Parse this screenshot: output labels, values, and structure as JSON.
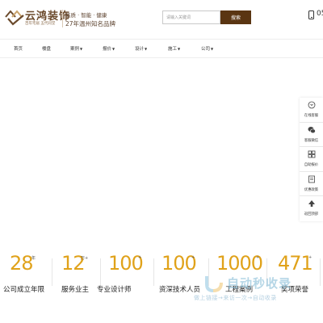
{
  "header": {
    "brand_name": "云鸿装饰",
    "brand_sub": "百年宅居 五代同堂",
    "slogan_line1": "高质 · 智能 · 健康",
    "slogan_line2": "27年温州知名品牌",
    "search_placeholder": "请输入关键词",
    "search_button": "搜索",
    "phone": "05",
    "brand_color": "#5a3512"
  },
  "nav": {
    "items": [
      {
        "label": "首页",
        "has_arrow": false
      },
      {
        "label": "楼盘",
        "has_arrow": false
      },
      {
        "label": "案例",
        "has_arrow": true
      },
      {
        "label": "报价",
        "has_arrow": true
      },
      {
        "label": "设计",
        "has_arrow": true
      },
      {
        "label": "施工",
        "has_arrow": true
      },
      {
        "label": "公司",
        "has_arrow": true
      }
    ],
    "arrow": "▼"
  },
  "side_bar": {
    "items": [
      {
        "label": "在线客服",
        "icon": "chat-bubble-icon"
      },
      {
        "label": "客服微信",
        "icon": "wechat-icon"
      },
      {
        "label": "自助报价",
        "icon": "calculator-icon"
      },
      {
        "label": "优惠政策",
        "icon": "gift-icon"
      },
      {
        "label": "返回顶部",
        "icon": "arrow-up-icon"
      }
    ]
  },
  "stats": {
    "accent_color": "#e0a21a",
    "items": [
      {
        "number": "28",
        "suffix": "年",
        "label": "公司成立年限"
      },
      {
        "number": "12",
        "suffix": "万+",
        "label": "服务业主"
      },
      {
        "number": "100",
        "suffix": "+",
        "label": "专业设计师"
      },
      {
        "number": "100",
        "suffix": "+",
        "label": "资深技术人员"
      },
      {
        "number": "1000",
        "suffix": "+",
        "label": "工程案例"
      },
      {
        "number": "471",
        "suffix": "+",
        "label": "奖项荣誉"
      }
    ]
  },
  "watermark": {
    "text": "自动秒收录",
    "sub": "做上链接→来访一次→自动收录"
  }
}
